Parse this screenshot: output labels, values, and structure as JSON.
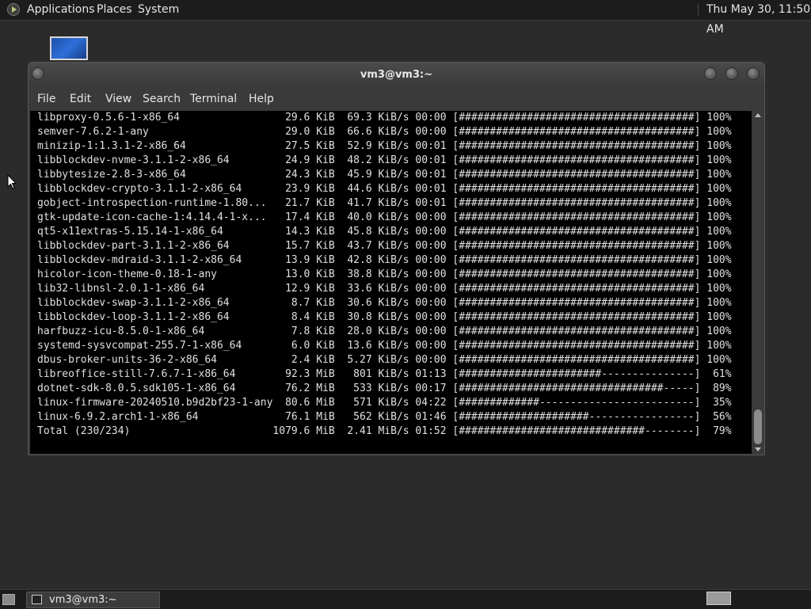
{
  "top_panel": {
    "menus": [
      "Applications",
      "Places",
      "System"
    ],
    "clock": "Thu May 30, 11:50 AM"
  },
  "window": {
    "title": "vm3@vm3:~",
    "menu": [
      "File",
      "Edit",
      "View",
      "Search",
      "Terminal",
      "Help"
    ]
  },
  "terminal": {
    "lines": [
      "libproxy-0.5.6-1-x86_64                 29.6 KiB  69.3 KiB/s 00:00 [######################################] 100%",
      "semver-7.6.2-1-any                      29.0 KiB  66.6 KiB/s 00:00 [######################################] 100%",
      "minizip-1:1.3.1-2-x86_64                27.5 KiB  52.9 KiB/s 00:01 [######################################] 100%",
      "libblockdev-nvme-3.1.1-2-x86_64         24.9 KiB  48.2 KiB/s 00:01 [######################################] 100%",
      "libbytesize-2.8-3-x86_64                24.3 KiB  45.9 KiB/s 00:01 [######################################] 100%",
      "libblockdev-crypto-3.1.1-2-x86_64       23.9 KiB  44.6 KiB/s 00:01 [######################################] 100%",
      "gobject-introspection-runtime-1.80...   21.7 KiB  41.7 KiB/s 00:01 [######################################] 100%",
      "gtk-update-icon-cache-1:4.14.4-1-x...   17.4 KiB  40.0 KiB/s 00:00 [######################################] 100%",
      "qt5-x11extras-5.15.14-1-x86_64          14.3 KiB  45.8 KiB/s 00:00 [######################################] 100%",
      "libblockdev-part-3.1.1-2-x86_64         15.7 KiB  43.7 KiB/s 00:00 [######################################] 100%",
      "libblockdev-mdraid-3.1.1-2-x86_64       13.9 KiB  42.8 KiB/s 00:00 [######################################] 100%",
      "hicolor-icon-theme-0.18-1-any           13.0 KiB  38.8 KiB/s 00:00 [######################################] 100%",
      "lib32-libnsl-2.0.1-1-x86_64             12.9 KiB  33.6 KiB/s 00:00 [######################################] 100%",
      "libblockdev-swap-3.1.1-2-x86_64          8.7 KiB  30.6 KiB/s 00:00 [######################################] 100%",
      "libblockdev-loop-3.1.1-2-x86_64          8.4 KiB  30.8 KiB/s 00:00 [######################################] 100%",
      "harfbuzz-icu-8.5.0-1-x86_64              7.8 KiB  28.0 KiB/s 00:00 [######################################] 100%",
      "systemd-sysvcompat-255.7-1-x86_64        6.0 KiB  13.6 KiB/s 00:00 [######################################] 100%",
      "dbus-broker-units-36-2-x86_64            2.4 KiB  5.27 KiB/s 00:00 [######################################] 100%",
      "libreoffice-still-7.6.7-1-x86_64        92.3 MiB   801 KiB/s 01:13 [#######################---------------]  61%",
      "dotnet-sdk-8.0.5.sdk105-1-x86_64        76.2 MiB   533 KiB/s 00:17 [#################################-----]  89%",
      "linux-firmware-20240510.b9d2bf23-1-any  80.6 MiB   571 KiB/s 04:22 [#############-------------------------]  35%",
      "linux-6.9.2.arch1-1-x86_64              76.1 MiB   562 KiB/s 01:46 [#####################-----------------]  56%",
      "Total (230/234)                       1079.6 MiB  2.41 MiB/s 01:52 [##############################--------]  79%"
    ]
  },
  "taskbar": {
    "task_label": "vm3@vm3:~"
  }
}
